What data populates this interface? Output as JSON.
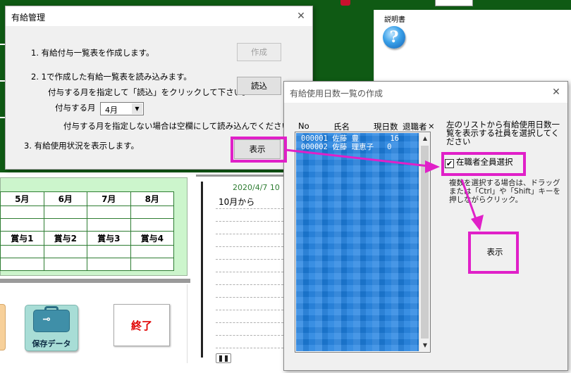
{
  "background": {
    "help_label": "説明書",
    "help_icon_glyph": "?",
    "salary_table": {
      "months": [
        "5月",
        "6月",
        "7月",
        "8月"
      ],
      "bonuses": [
        "賞与1",
        "賞与2",
        "賞与3",
        "賞与4"
      ]
    },
    "save_button_label": "保存データ",
    "exit_button_label": "終了",
    "notebook_date": "2020/4/7 10",
    "notebook_text": "10月から"
  },
  "dialog1": {
    "title": "有給管理",
    "close_glyph": "✕",
    "step1_text": "1. 有給付与一覧表を作成します。",
    "create_button": "作成",
    "step2_text": "2. 1で作成した有給一覧表を読み込みます。",
    "step2_subtext": "付与する月を指定して「読込」をクリックして下さい。",
    "load_button": "読込",
    "month_label": "付与する月",
    "month_value": "4月",
    "month_note": "付与する月を指定しない場合は空欄にして読み込んでください。",
    "step3_text": "3. 有給使用状況を表示します。",
    "display_button": "表示"
  },
  "dialog2": {
    "title": "有給使用日数一覧の作成",
    "close_glyph": "✕",
    "columns": [
      "No",
      "氏名",
      "現日数",
      "退職者"
    ],
    "column_x_mark": "×",
    "rows": [
      {
        "no": "000001",
        "name": "佐藤 豊",
        "days": "16"
      },
      {
        "no": "000002",
        "name": "佐藤 理恵子",
        "days": "0"
      }
    ],
    "instruction": "左のリストから有給使用日数一覧を表示する社員を選択してください",
    "checkbox_label": "在職者全員選択",
    "checkbox_checked": true,
    "checkbox_glyph": "✔",
    "multi_instruction": "複数を選択する場合は、ドラッグまたは「Ctrl」や「Shift」キーを押しながらクリック。",
    "display_button": "表示"
  },
  "annotation_color": "#e020c8",
  "list_color": "#1d7fe0"
}
